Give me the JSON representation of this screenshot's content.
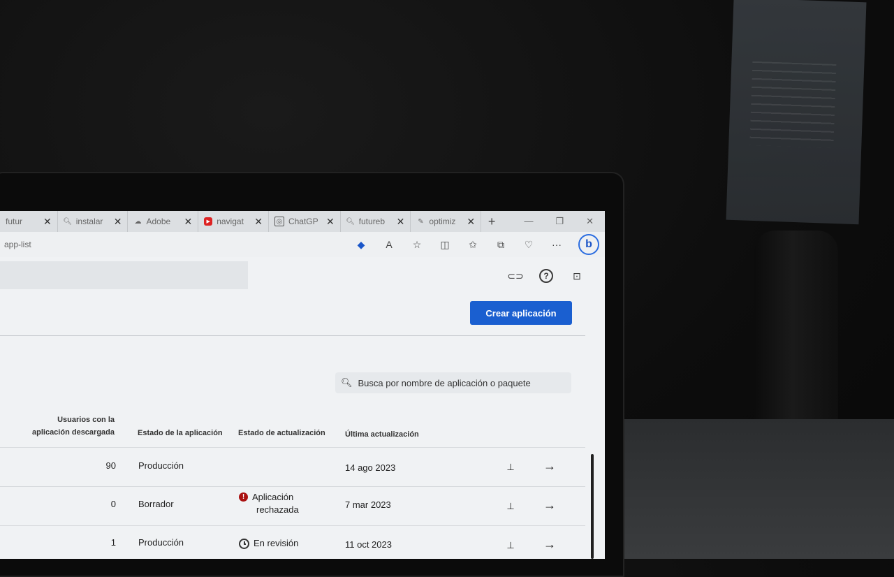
{
  "browser": {
    "tabs": [
      {
        "icon": "search-icon",
        "title": "futur"
      },
      {
        "icon": "search-icon",
        "title": "instalar"
      },
      {
        "icon": "cloud-icon",
        "title": "Adobe"
      },
      {
        "icon": "youtube-icon",
        "title": "navigat"
      },
      {
        "icon": "chatgpt-icon",
        "title": "ChatGP"
      },
      {
        "icon": "search-icon",
        "title": "futureb"
      },
      {
        "icon": "edit-icon",
        "title": "optimiz"
      }
    ],
    "new_tab": "+",
    "url": "app-list"
  },
  "header": {
    "create_button": "Crear aplicación"
  },
  "search": {
    "placeholder": "Busca por nombre de aplicación o paquete"
  },
  "table": {
    "columns": {
      "users_line1": "Usuarios con la",
      "users_line2": "aplicación descargada",
      "app_state": "Estado de la aplicación",
      "update_state": "Estado de actualización",
      "last_update": "Última actualización"
    },
    "rows": [
      {
        "users": "90",
        "state": "Producción",
        "update_line1": "",
        "update_line2": "",
        "date": "14 ago 2023"
      },
      {
        "users": "0",
        "state": "Borrador",
        "update_line1": "Aplicación",
        "update_line2": "rechazada",
        "date": "7 mar 2023"
      },
      {
        "users": "1",
        "state": "Producción",
        "update_line1": "En revisión",
        "update_line2": "",
        "date": "11 oct 2023"
      }
    ]
  }
}
